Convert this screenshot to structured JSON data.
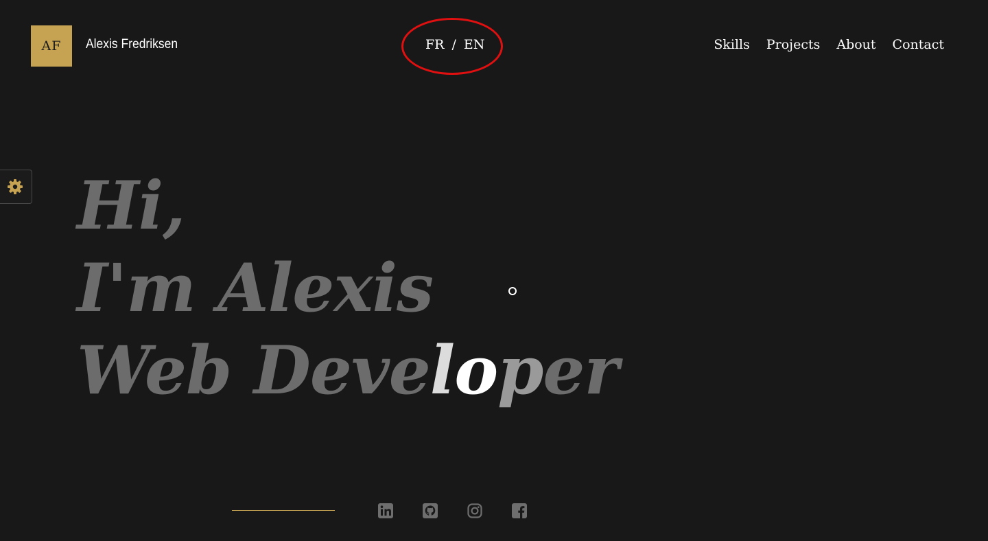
{
  "header": {
    "logo_initials": "AF",
    "brand_name": "Alexis Fredriksen",
    "language": {
      "fr": "FR",
      "separator": "/",
      "en": "EN"
    },
    "nav": [
      "Skills",
      "Projects",
      "About",
      "Contact"
    ]
  },
  "settings": {
    "icon": "gear-icon"
  },
  "hero": {
    "greeting": "Hi,",
    "intro": "I'm Alexis",
    "title_before": "Web Deve",
    "title_highlight_1": "l",
    "title_highlight_2": "o",
    "title_highlight_3": "p",
    "title_after": "er"
  },
  "social": [
    {
      "name": "linkedin-icon"
    },
    {
      "name": "github-icon"
    },
    {
      "name": "instagram-icon"
    },
    {
      "name": "facebook-icon"
    }
  ],
  "colors": {
    "background": "#181818",
    "accent_gold": "#c6a352",
    "text_white": "#ffffff",
    "text_muted": "#6c6c6c",
    "annotation_red": "#e01010"
  }
}
